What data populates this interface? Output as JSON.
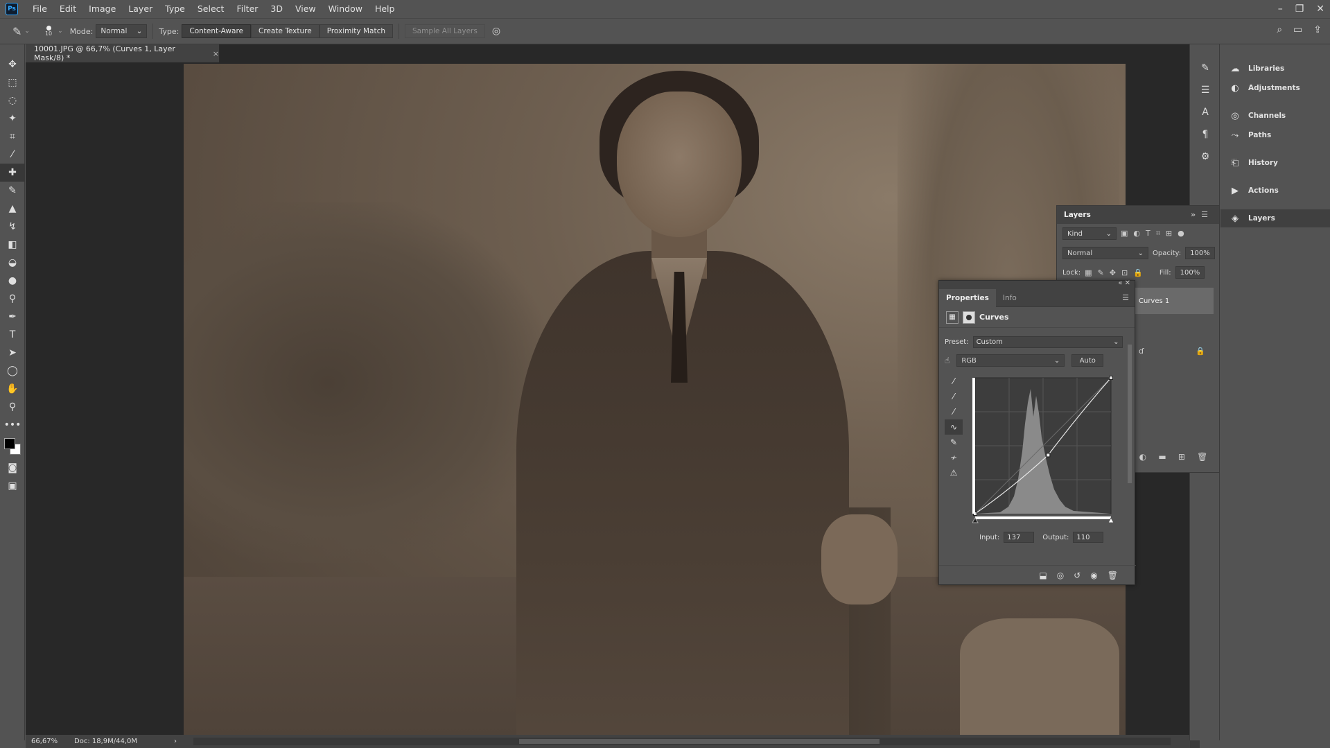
{
  "app": {
    "logo": "Ps"
  },
  "menu": [
    "File",
    "Edit",
    "Image",
    "Layer",
    "Type",
    "Select",
    "Filter",
    "3D",
    "View",
    "Window",
    "Help"
  ],
  "options": {
    "brush_size": "10",
    "mode_label": "Mode:",
    "mode_value": "Normal",
    "type_label": "Type:",
    "type_content_aware": "Content-Aware",
    "type_create_texture": "Create Texture",
    "type_proximity": "Proximity Match",
    "sample_all_layers": "Sample All Layers"
  },
  "document": {
    "tab_title": "10001.JPG @ 66,7% (Curves 1, Layer Mask/8) *",
    "close": "×"
  },
  "status": {
    "zoom": "66,67%",
    "doc_size": "Doc: 18,9M/44,0M"
  },
  "right_panel": {
    "items": [
      {
        "label": "Libraries",
        "icon": "cloud-icon"
      },
      {
        "label": "Adjustments",
        "icon": "adjustments-icon"
      },
      {
        "label": "Channels",
        "icon": "channels-icon"
      },
      {
        "label": "Paths",
        "icon": "paths-icon"
      },
      {
        "label": "History",
        "icon": "history-icon"
      },
      {
        "label": "Actions",
        "icon": "play-icon"
      },
      {
        "label": "Layers",
        "icon": "layers-icon"
      }
    ]
  },
  "layers_panel": {
    "title": "Layers",
    "kind": "Kind",
    "blend": "Normal",
    "opacity_label": "Opacity:",
    "opacity_value": "100%",
    "lock_label": "Lock:",
    "fill_label": "Fill:",
    "fill_value": "100%",
    "layer_name": "Curves 1"
  },
  "properties": {
    "tab_properties": "Properties",
    "tab_info": "Info",
    "title": "Curves",
    "preset_label": "Preset:",
    "preset_value": "Custom",
    "channel_value": "RGB",
    "auto_label": "Auto",
    "input_label": "Input:",
    "input_value": "137",
    "output_label": "Output:",
    "output_value": "110"
  },
  "curve": {
    "points": [
      [
        0,
        0
      ],
      [
        137,
        110
      ],
      [
        255,
        255
      ]
    ]
  }
}
